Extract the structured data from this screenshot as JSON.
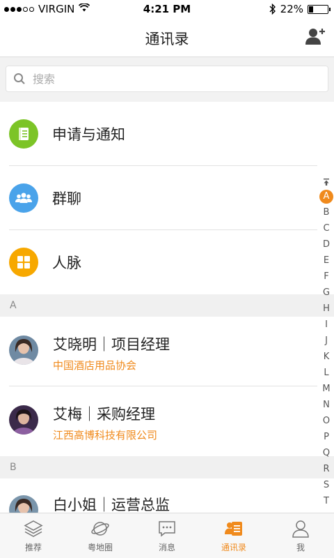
{
  "status_bar": {
    "carrier": "VIRGIN",
    "time": "4:21 PM",
    "battery": "22%",
    "battery_level": 0.22
  },
  "header": {
    "title": "通讯录"
  },
  "search": {
    "placeholder": "搜索"
  },
  "fixed_items": [
    {
      "label": "申请与通知",
      "icon": "notebook-icon",
      "color": "#7cc427"
    },
    {
      "label": "群聊",
      "icon": "group-icon",
      "color": "#4aa3ea"
    },
    {
      "label": "人脉",
      "icon": "grid-icon",
      "color": "#f7a800"
    }
  ],
  "sections": [
    {
      "letter": "A",
      "contacts": [
        {
          "name": "艾晓明｜项目经理",
          "company": "中国酒店用品协会"
        },
        {
          "name": "艾梅｜采购经理",
          "company": "江西高博科技有限公司"
        }
      ]
    },
    {
      "letter": "B",
      "contacts": [
        {
          "name": "白小姐｜运营总监",
          "company": ""
        }
      ]
    }
  ],
  "index_bar": {
    "top_icon": "scroll-top-icon",
    "letters": [
      "A",
      "B",
      "C",
      "D",
      "E",
      "F",
      "G",
      "H",
      "I",
      "J",
      "K",
      "L",
      "M",
      "N",
      "O",
      "P",
      "Q",
      "R",
      "S",
      "T"
    ],
    "active": "A"
  },
  "tabs": [
    {
      "label": "推荐",
      "icon": "layers-icon",
      "active": false
    },
    {
      "label": "粤地圈",
      "icon": "planet-icon",
      "active": false
    },
    {
      "label": "消息",
      "icon": "chat-icon",
      "active": false
    },
    {
      "label": "通讯录",
      "icon": "contacts-icon",
      "active": true
    },
    {
      "label": "我",
      "icon": "person-icon",
      "active": false
    }
  ],
  "colors": {
    "accent": "#f08a1c"
  }
}
